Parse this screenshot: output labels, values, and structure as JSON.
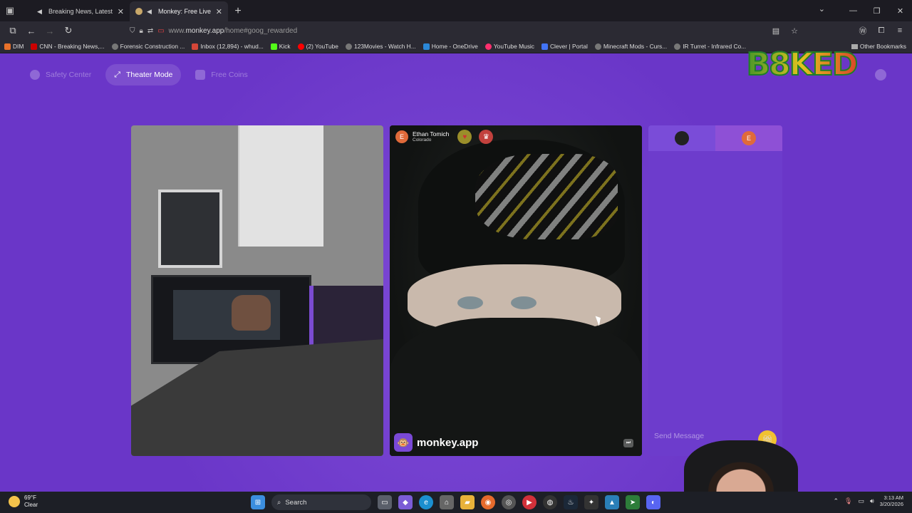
{
  "browser": {
    "tabs": [
      {
        "title": "Breaking News, Latest New",
        "active": false
      },
      {
        "title": "Monkey: Free Live Video Ch",
        "active": true
      }
    ],
    "url_prefix": "www.",
    "url_domain": "monkey.app",
    "url_path": "/home#goog_rewarded",
    "bookmarks": [
      "DIM",
      "CNN - Breaking News,...",
      "Forensic Construction ...",
      "Inbox (12,894) - whud...",
      "Kick",
      "(2) YouTube",
      "123Movies - Watch H...",
      "Home - OneDrive",
      "YouTube Music",
      "Clever | Portal",
      "Minecraft Mods - Curs...",
      "IR Turret - Infrared Co..."
    ],
    "other_bookmarks": "Other Bookmarks"
  },
  "page": {
    "nav": {
      "safety": "Safety Center",
      "theater": "Theater Mode",
      "coins": "Free Coins"
    },
    "caller": {
      "initial": "E",
      "name": "Ethan Tomich",
      "location": "Colorado"
    },
    "brand": "monkey.app",
    "chat": {
      "other_initial": "E",
      "placeholder": "Send Message"
    }
  },
  "overlay": {
    "logo_text": "B8KED"
  },
  "taskbar": {
    "temp": "69°F",
    "condition": "Clear",
    "search": "Search",
    "time": "3:13 AM",
    "date": "3/20/2026"
  },
  "colors": {
    "page_bg": "#6a36c8",
    "chat_bg": "#6d3ccc",
    "avatar": "#e06a3a",
    "gift": "#f1c232"
  }
}
